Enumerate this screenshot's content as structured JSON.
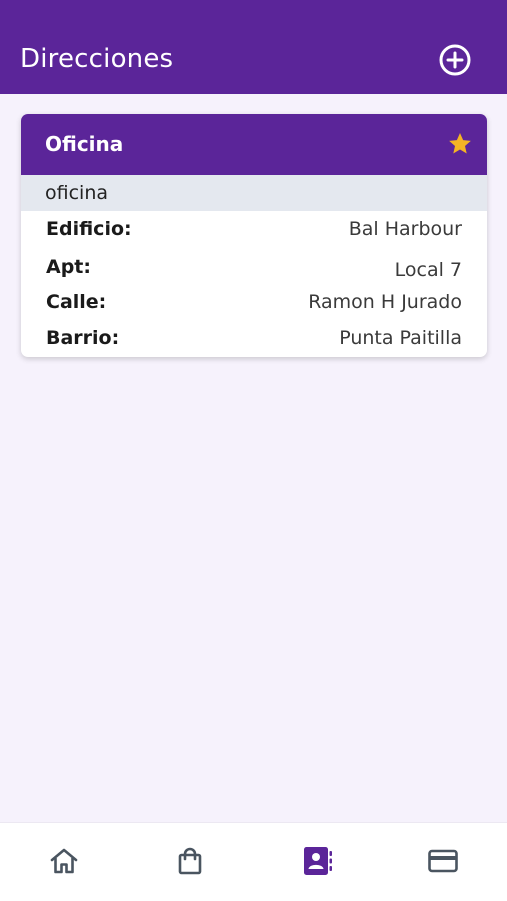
{
  "app_bar": {
    "title": "Direcciones",
    "add_icon": "plus-circle-icon"
  },
  "address_card": {
    "title": "Oficina",
    "favorite_icon": "star-icon",
    "favorite_color": "#f5b324",
    "subtitle": "oficina",
    "fields": [
      {
        "label": "Edificio:",
        "value": "Bal Harbour"
      },
      {
        "label": "Apt:",
        "value": "Local 7"
      },
      {
        "label": "Calle:",
        "value": "Ramon H Jurado"
      },
      {
        "label": "Barrio:",
        "value": "Punta Paitilla"
      }
    ]
  },
  "bottom_nav": {
    "items": [
      {
        "icon": "home-icon",
        "active": false
      },
      {
        "icon": "shopping-bag-icon",
        "active": false
      },
      {
        "icon": "contacts-icon",
        "active": true
      },
      {
        "icon": "credit-card-icon",
        "active": false
      }
    ]
  },
  "colors": {
    "primary": "#5b2599",
    "background": "#f6f2fc",
    "subheader": "#e4e8ef",
    "nav_icon": "#4a5560",
    "nav_icon_active": "#5b2599"
  }
}
